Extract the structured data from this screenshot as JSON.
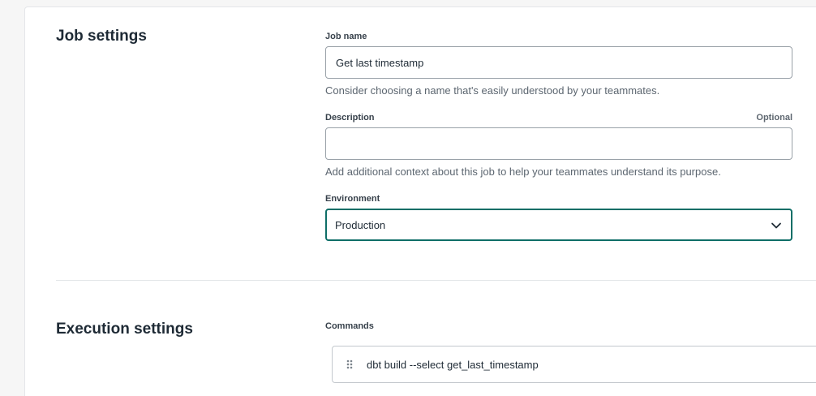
{
  "job_settings": {
    "title": "Job settings",
    "job_name": {
      "label": "Job name",
      "value": "Get last timestamp",
      "help": "Consider choosing a name that's easily understood by your teammates."
    },
    "description": {
      "label": "Description",
      "optional_label": "Optional",
      "value": "",
      "help": "Add additional context about this job to help your teammates understand its purpose."
    },
    "environment": {
      "label": "Environment",
      "selected": "Production",
      "icon": "chevron-down-icon"
    }
  },
  "execution_settings": {
    "title": "Execution settings",
    "commands_label": "Commands",
    "commands": [
      {
        "text": "dbt build --select get_last_timestamp",
        "icon": "drag-handle-icon"
      }
    ]
  },
  "colors": {
    "focus_border": "#0e6e67",
    "text": "#1e2a35",
    "muted": "#5c6670"
  }
}
